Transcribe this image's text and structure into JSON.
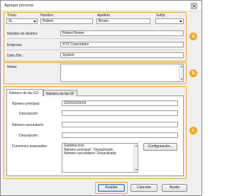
{
  "window": {
    "title": "Agregar persona"
  },
  "name_section": {
    "title_label": "Título:",
    "title_value": "Sr.",
    "first_name_label": "Nombre:",
    "first_name_value": "Robert",
    "last_name_label": "Apellido:",
    "last_name_value": "Brown",
    "suffix_label": "Sufijo:",
    "suffix_value": ""
  },
  "details": {
    "destination_label": "Nombre de destino:",
    "destination_value": "Robert Brown",
    "company_label": "Empresa:",
    "company_value": "XYZ Corporation",
    "department_label": "Dpto./Div.:",
    "department_value": "System"
  },
  "notes": {
    "label": "Notas:",
    "value": ""
  },
  "tabs": [
    {
      "label": "Número de fax G3",
      "active": true
    },
    {
      "label": "Número de fax IP",
      "active": false
    }
  ],
  "fax": {
    "main_number_label": "Número principal:",
    "main_number_value": "123XXXXXXX",
    "description1_label": "Descripción",
    "description1_value": "",
    "secondary_number_label": "Número secundario:",
    "secondary_number_value": "",
    "description2_label": "Descripción :",
    "description2_value": "",
    "advanced_label": "Funciones avanzadas:",
    "advanced_lines": [
      "Subdirección",
      "Número principal :  Desactivado",
      "Número secundario: Desactivado"
    ],
    "configure_button": "Configuración..."
  },
  "buttons": {
    "accept": "Aceptar",
    "cancel": "Cancelar",
    "help": "Ayuda"
  },
  "callouts": {
    "a": "a",
    "b": "b",
    "c": "c"
  },
  "colors": {
    "callout": "#f5a623",
    "default_button_border": "#3c7fb1"
  },
  "icons": {
    "close": "close-icon",
    "dropdown": "chevron-down-icon"
  }
}
